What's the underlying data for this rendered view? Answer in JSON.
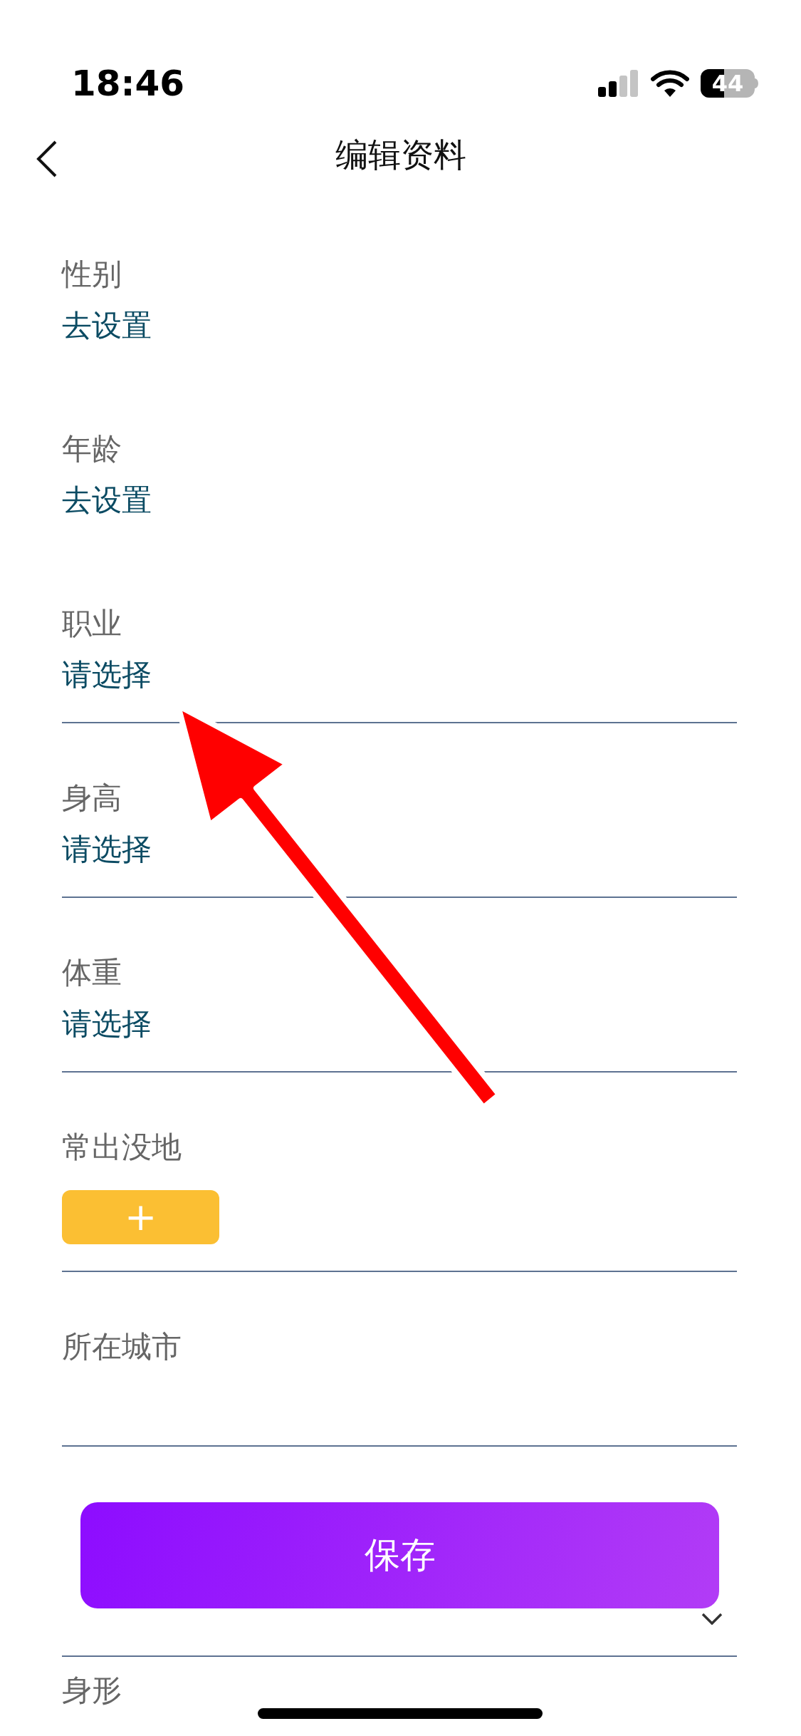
{
  "status_bar": {
    "time": "18:46",
    "battery": "44"
  },
  "nav": {
    "title": "编辑资料"
  },
  "fields": [
    {
      "kind": "select",
      "label": "性别",
      "value": "去设置",
      "divider": false
    },
    {
      "kind": "select",
      "label": "年龄",
      "value": "去设置",
      "divider": false
    },
    {
      "kind": "select",
      "label": "职业",
      "value": "请选择",
      "divider": true
    },
    {
      "kind": "select",
      "label": "身高",
      "value": "请选择",
      "divider": true
    },
    {
      "kind": "select",
      "label": "体重",
      "value": "请选择",
      "divider": true
    },
    {
      "kind": "add",
      "label": "常出没地",
      "button": "+",
      "divider": true
    },
    {
      "kind": "empty",
      "label": "所在城市",
      "divider": true
    },
    {
      "kind": "dropdown",
      "divider": true
    },
    {
      "kind": "select",
      "label": "身形"
    }
  ],
  "save_button": "保存"
}
